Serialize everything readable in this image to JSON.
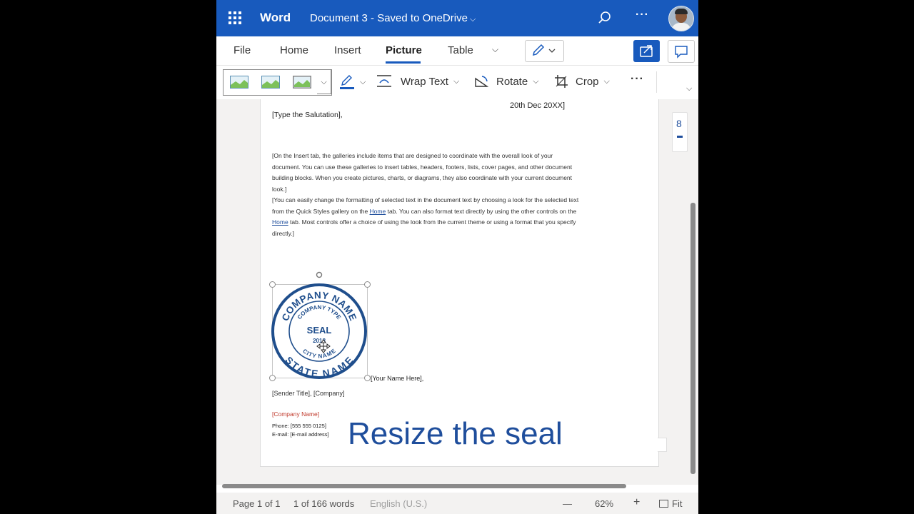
{
  "titlebar": {
    "app_name": "Word",
    "doc_name": "Document 3 - Saved to OneDrive",
    "more": "···",
    "icons": [
      "app-launcher-icon",
      "search-icon",
      "more-icon",
      "avatar"
    ]
  },
  "tabs": [
    {
      "label": "File"
    },
    {
      "label": "Home"
    },
    {
      "label": "Insert"
    },
    {
      "label": "Picture",
      "active": true
    },
    {
      "label": "Table"
    }
  ],
  "toolbar": {
    "wrap_text": "Wrap Text",
    "rotate": "Rotate",
    "crop": "Crop",
    "more": "···"
  },
  "document": {
    "date": "20th Dec 20XX]",
    "salutation": "[Type the Salutation],",
    "para1": "[On the Insert tab, the galleries include items that are designed to coordinate with the overall look of your document. You can use these galleries to insert tables, headers, footers, lists, cover pages, and other document building blocks. When you create pictures, charts, or diagrams, they also coordinate with your current document look.]",
    "para2_a": "[You can easily change the formatting of selected text in the document text by choosing a look for the selected text from the Quick Styles gallery on the ",
    "para2_link1": "Home",
    "para2_b": " tab. You can also format text directly by using the other controls on the ",
    "para2_link2": "Home",
    "para2_c": " tab. Most controls offer a choice of using the look from the current theme or using a format that you specify directly.]",
    "your_name": "[Your Name Here],",
    "sender_title": "[Sender Title], [Company]",
    "company_name": "[Company Name]",
    "phone": "Phone: [555 555 0125]",
    "email": "E-mail: [E-mail address]",
    "seal": {
      "top_text": "COMPANY NAME",
      "inner_text": "COMPANY TYPE",
      "center_text": "SEAL",
      "year_text": "2018",
      "city_text": "CITY NAME",
      "bottom_text": "STATE NAME",
      "color": "#1f4e8c"
    }
  },
  "side_nav_number": "8",
  "caption": "Resize the seal",
  "statusbar": {
    "page": "Page 1 of 1",
    "words": "1 of 166 words",
    "language": "English (U.S.)",
    "zoom_out": "—",
    "zoom": "62%",
    "zoom_in": "+",
    "fit": "Fit"
  },
  "colors": {
    "brand": "#185abd",
    "caption": "#1f4e9c"
  }
}
